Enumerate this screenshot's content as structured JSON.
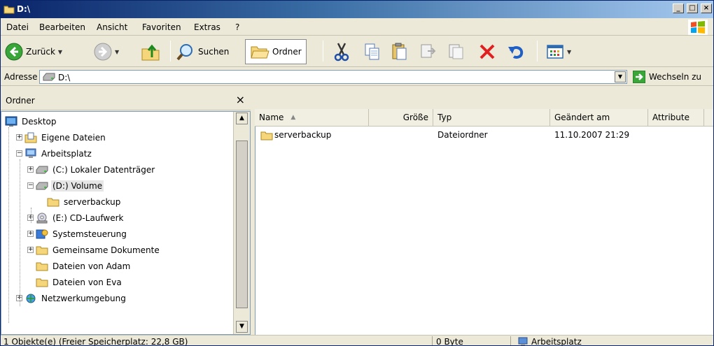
{
  "window": {
    "title": "D:\\"
  },
  "menu": [
    "Datei",
    "Bearbeiten",
    "Ansicht",
    "Favoriten",
    "Extras",
    "?"
  ],
  "toolbar": {
    "back_label": "Zurück",
    "search_label": "Suchen",
    "folders_label": "Ordner",
    "icons": [
      "back-icon",
      "forward-icon",
      "up-folder-icon",
      "search-icon",
      "folders-icon",
      "cut-icon",
      "copy-icon",
      "paste-icon",
      "move-to-icon",
      "copy-to-icon",
      "delete-icon",
      "undo-icon",
      "views-icon"
    ]
  },
  "address": {
    "label": "Adresse",
    "value": "D:\\",
    "go_label": "Wechseln zu"
  },
  "folder_pane": {
    "title": "Ordner",
    "close": "×",
    "tree": [
      {
        "label": "Desktop",
        "icon": "desktop-icon"
      },
      {
        "label": "Eigene Dateien",
        "icon": "my-documents-icon",
        "expander": "+"
      },
      {
        "label": "Arbeitsplatz",
        "icon": "my-computer-icon",
        "expander": "−"
      },
      {
        "label": "(C:) Lokaler Datenträger",
        "icon": "drive-icon",
        "expander": "+"
      },
      {
        "label": "(D:) Volume",
        "icon": "drive-icon",
        "expander": "−",
        "selected": true
      },
      {
        "label": "serverbackup",
        "icon": "folder-icon"
      },
      {
        "label": "(E:) CD-Laufwerk",
        "icon": "cd-drive-icon",
        "expander": "+"
      },
      {
        "label": "Systemsteuerung",
        "icon": "control-panel-icon",
        "expander": "+"
      },
      {
        "label": "Gemeinsame Dokumente",
        "icon": "folder-icon",
        "expander": "+"
      },
      {
        "label": "Dateien von Adam",
        "icon": "folder-icon"
      },
      {
        "label": "Dateien von Eva",
        "icon": "folder-icon"
      },
      {
        "label": "Netzwerkumgebung",
        "icon": "network-icon",
        "expander": "+"
      }
    ]
  },
  "file_list": {
    "columns": [
      "Name",
      "Größe",
      "Typ",
      "Geändert am",
      "Attribute"
    ],
    "sort_indicator": "▲",
    "rows": [
      {
        "name": "serverbackup",
        "size": "",
        "type": "Dateiordner",
        "modified": "11.10.2007 21:29",
        "attributes": ""
      }
    ]
  },
  "status": {
    "objects": "1 Objekte(e) (Freier Speicherplatz: 22,8 GB)",
    "size": "0 Byte",
    "location": "Arbeitsplatz"
  },
  "colors": {
    "titlebar_start": "#0a246a",
    "titlebar_end": "#a6caf0",
    "chrome": "#ece9d8",
    "folder_yellow": "#f5d67a"
  }
}
